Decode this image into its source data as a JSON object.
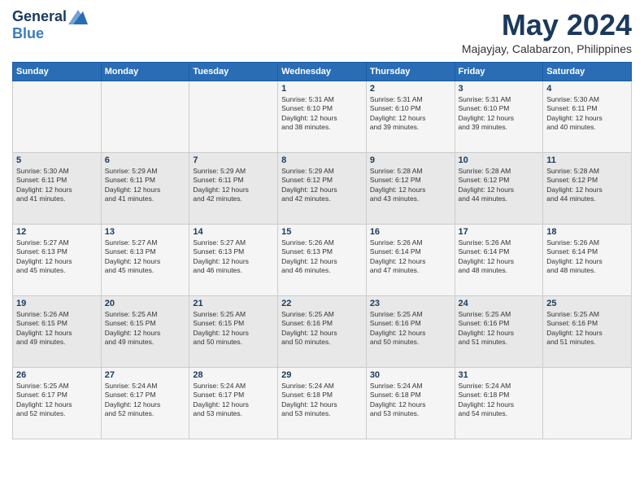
{
  "logo": {
    "general": "General",
    "blue": "Blue"
  },
  "title": "May 2024",
  "subtitle": "Majayjay, Calabarzon, Philippines",
  "weekdays": [
    "Sunday",
    "Monday",
    "Tuesday",
    "Wednesday",
    "Thursday",
    "Friday",
    "Saturday"
  ],
  "weeks": [
    [
      {
        "day": "",
        "info": ""
      },
      {
        "day": "",
        "info": ""
      },
      {
        "day": "",
        "info": ""
      },
      {
        "day": "1",
        "info": "Sunrise: 5:31 AM\nSunset: 6:10 PM\nDaylight: 12 hours\nand 38 minutes."
      },
      {
        "day": "2",
        "info": "Sunrise: 5:31 AM\nSunset: 6:10 PM\nDaylight: 12 hours\nand 39 minutes."
      },
      {
        "day": "3",
        "info": "Sunrise: 5:31 AM\nSunset: 6:10 PM\nDaylight: 12 hours\nand 39 minutes."
      },
      {
        "day": "4",
        "info": "Sunrise: 5:30 AM\nSunset: 6:11 PM\nDaylight: 12 hours\nand 40 minutes."
      }
    ],
    [
      {
        "day": "5",
        "info": "Sunrise: 5:30 AM\nSunset: 6:11 PM\nDaylight: 12 hours\nand 41 minutes."
      },
      {
        "day": "6",
        "info": "Sunrise: 5:29 AM\nSunset: 6:11 PM\nDaylight: 12 hours\nand 41 minutes."
      },
      {
        "day": "7",
        "info": "Sunrise: 5:29 AM\nSunset: 6:11 PM\nDaylight: 12 hours\nand 42 minutes."
      },
      {
        "day": "8",
        "info": "Sunrise: 5:29 AM\nSunset: 6:12 PM\nDaylight: 12 hours\nand 42 minutes."
      },
      {
        "day": "9",
        "info": "Sunrise: 5:28 AM\nSunset: 6:12 PM\nDaylight: 12 hours\nand 43 minutes."
      },
      {
        "day": "10",
        "info": "Sunrise: 5:28 AM\nSunset: 6:12 PM\nDaylight: 12 hours\nand 44 minutes."
      },
      {
        "day": "11",
        "info": "Sunrise: 5:28 AM\nSunset: 6:12 PM\nDaylight: 12 hours\nand 44 minutes."
      }
    ],
    [
      {
        "day": "12",
        "info": "Sunrise: 5:27 AM\nSunset: 6:13 PM\nDaylight: 12 hours\nand 45 minutes."
      },
      {
        "day": "13",
        "info": "Sunrise: 5:27 AM\nSunset: 6:13 PM\nDaylight: 12 hours\nand 45 minutes."
      },
      {
        "day": "14",
        "info": "Sunrise: 5:27 AM\nSunset: 6:13 PM\nDaylight: 12 hours\nand 46 minutes."
      },
      {
        "day": "15",
        "info": "Sunrise: 5:26 AM\nSunset: 6:13 PM\nDaylight: 12 hours\nand 46 minutes."
      },
      {
        "day": "16",
        "info": "Sunrise: 5:26 AM\nSunset: 6:14 PM\nDaylight: 12 hours\nand 47 minutes."
      },
      {
        "day": "17",
        "info": "Sunrise: 5:26 AM\nSunset: 6:14 PM\nDaylight: 12 hours\nand 48 minutes."
      },
      {
        "day": "18",
        "info": "Sunrise: 5:26 AM\nSunset: 6:14 PM\nDaylight: 12 hours\nand 48 minutes."
      }
    ],
    [
      {
        "day": "19",
        "info": "Sunrise: 5:26 AM\nSunset: 6:15 PM\nDaylight: 12 hours\nand 49 minutes."
      },
      {
        "day": "20",
        "info": "Sunrise: 5:25 AM\nSunset: 6:15 PM\nDaylight: 12 hours\nand 49 minutes."
      },
      {
        "day": "21",
        "info": "Sunrise: 5:25 AM\nSunset: 6:15 PM\nDaylight: 12 hours\nand 50 minutes."
      },
      {
        "day": "22",
        "info": "Sunrise: 5:25 AM\nSunset: 6:16 PM\nDaylight: 12 hours\nand 50 minutes."
      },
      {
        "day": "23",
        "info": "Sunrise: 5:25 AM\nSunset: 6:16 PM\nDaylight: 12 hours\nand 50 minutes."
      },
      {
        "day": "24",
        "info": "Sunrise: 5:25 AM\nSunset: 6:16 PM\nDaylight: 12 hours\nand 51 minutes."
      },
      {
        "day": "25",
        "info": "Sunrise: 5:25 AM\nSunset: 6:16 PM\nDaylight: 12 hours\nand 51 minutes."
      }
    ],
    [
      {
        "day": "26",
        "info": "Sunrise: 5:25 AM\nSunset: 6:17 PM\nDaylight: 12 hours\nand 52 minutes."
      },
      {
        "day": "27",
        "info": "Sunrise: 5:24 AM\nSunset: 6:17 PM\nDaylight: 12 hours\nand 52 minutes."
      },
      {
        "day": "28",
        "info": "Sunrise: 5:24 AM\nSunset: 6:17 PM\nDaylight: 12 hours\nand 53 minutes."
      },
      {
        "day": "29",
        "info": "Sunrise: 5:24 AM\nSunset: 6:18 PM\nDaylight: 12 hours\nand 53 minutes."
      },
      {
        "day": "30",
        "info": "Sunrise: 5:24 AM\nSunset: 6:18 PM\nDaylight: 12 hours\nand 53 minutes."
      },
      {
        "day": "31",
        "info": "Sunrise: 5:24 AM\nSunset: 6:18 PM\nDaylight: 12 hours\nand 54 minutes."
      },
      {
        "day": "",
        "info": ""
      }
    ]
  ]
}
